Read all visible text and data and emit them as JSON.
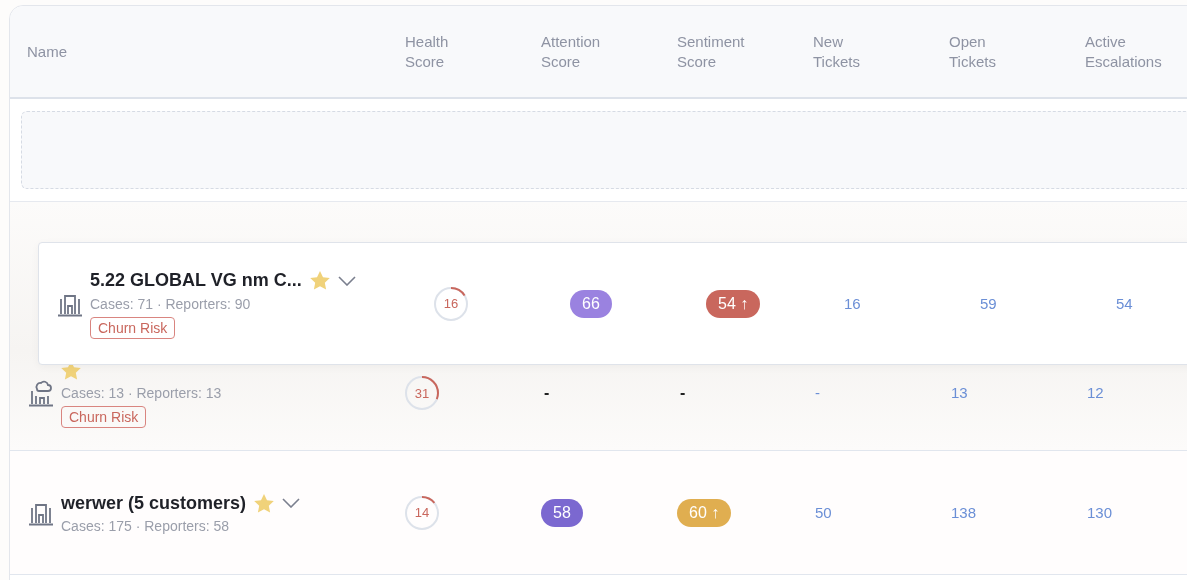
{
  "table": {
    "columns": [
      "Name",
      "Health Score",
      "Attention Score",
      "Sentiment Score",
      "New Tickets",
      "Open Tickets",
      "Active Escalations"
    ],
    "dragging_row": {
      "kind": "building",
      "name": "5.22 GLOBAL VG nm C...",
      "favorite": true,
      "expandable": true,
      "meta": "Cases: 71 · Reporters: 90",
      "tag": "Churn Risk",
      "health": {
        "value": "16",
        "level": 0.16
      },
      "attention": {
        "text": "66",
        "color": "#9a82e0"
      },
      "sentiment": {
        "text": "54 ↑",
        "color": "#c9675d"
      },
      "new_tickets": "16",
      "open_tickets": "59",
      "active_escalations": "54"
    },
    "rows": [
      {
        "kind": "cloud-building",
        "favorite": true,
        "meta": "Cases: 13 · Reporters: 13",
        "tag": "Churn Risk",
        "health": {
          "value": "31",
          "level": 0.31
        },
        "attention": {
          "text": "-"
        },
        "sentiment": {
          "text": "-"
        },
        "new_tickets": "-",
        "open_tickets": "13",
        "active_escalations": "12"
      },
      {
        "kind": "building",
        "name": "werwer (5 customers)",
        "favorite": true,
        "expandable": true,
        "meta": "Cases: 175 · Reporters: 58",
        "health": {
          "value": "14",
          "level": 0.14
        },
        "attention": {
          "text": "58",
          "color": "#7b68d0"
        },
        "sentiment": {
          "text": "60 ↑",
          "color": "#e0ae50"
        },
        "new_tickets": "50",
        "open_tickets": "138",
        "active_escalations": "130"
      }
    ]
  }
}
